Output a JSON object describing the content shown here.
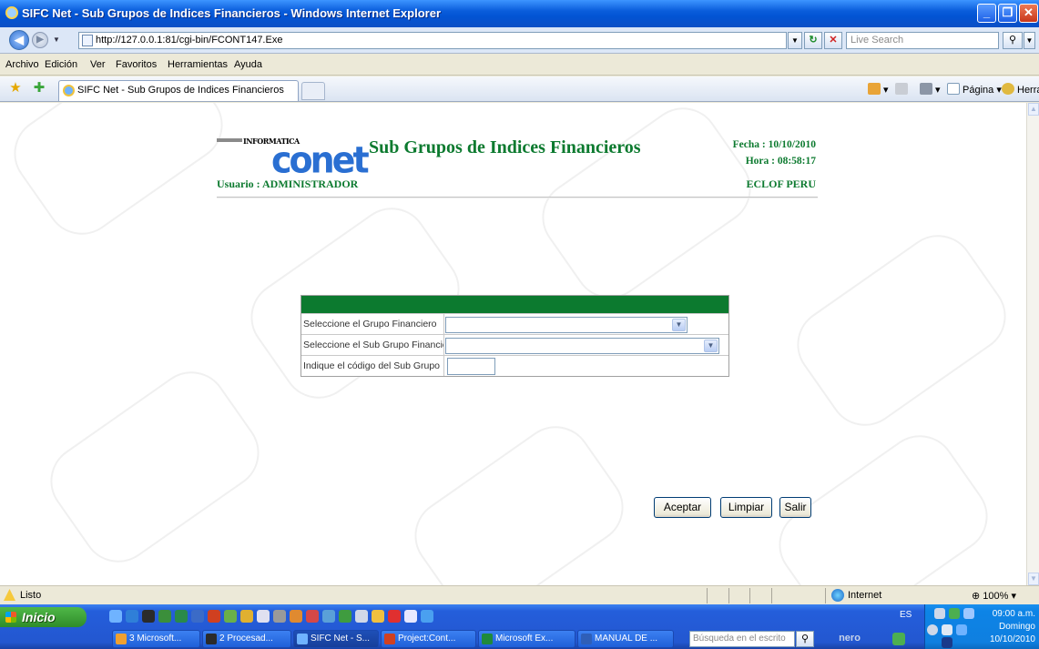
{
  "window": {
    "title": "SIFC Net - Sub Grupos de Indices Financieros - Windows Internet Explorer"
  },
  "address_bar": {
    "url": "http://127.0.0.1:81/cgi-bin/FCONT147.Exe",
    "search_placeholder": "Live Search"
  },
  "menu": [
    "Archivo",
    "Edición",
    "Ver",
    "Favoritos",
    "Herramientas",
    "Ayuda"
  ],
  "tabs": {
    "active_tab": "SIFC Net - Sub Grupos de Indices Financieros",
    "commands": {
      "page": "Página",
      "tools": "Herramientas"
    }
  },
  "page": {
    "logo_top": "INFORMATICA",
    "logo_main": "conet",
    "title": "Sub Grupos de Indices Financieros",
    "fecha": "Fecha : 10/10/2010",
    "hora": "Hora : 08:58:17",
    "usuario": "Usuario :  ADMINISTRADOR",
    "company": "ECLOF PERU"
  },
  "form": {
    "rows": [
      {
        "label": "Seleccione el Grupo Financiero",
        "value": ""
      },
      {
        "label": "Seleccione el Sub Grupo Financiero",
        "value": ""
      },
      {
        "label": "Indique el código del Sub Grupo",
        "value": ""
      }
    ],
    "buttons": {
      "accept": "Aceptar",
      "clear": "Limpiar",
      "exit": "Salir"
    }
  },
  "status_bar": {
    "status": "Listo",
    "zone": "Internet",
    "zoom": "100%"
  },
  "taskbar": {
    "start": "Inicio",
    "items": [
      {
        "label": "3 Microsoft...",
        "color": "#f0a030"
      },
      {
        "label": "2 Procesad...",
        "color": "#2b2b2b"
      },
      {
        "label": "SIFC Net - S...",
        "color": "#6fb3ff"
      },
      {
        "label": "Project:Cont...",
        "color": "#d04020"
      },
      {
        "label": "Microsoft Ex...",
        "color": "#1f8a3c"
      },
      {
        "label": "MANUAL DE ...",
        "color": "#2f5fb8"
      }
    ],
    "desktop_search": "Búsqueda en el escrito",
    "nero": "nero",
    "language": "ES",
    "time": "09:00 a.m.",
    "day": "Domingo",
    "date": "10/10/2010"
  },
  "colors": {
    "title_green": "#0c7a2f",
    "form_header": "#0c7a2f",
    "logo_blue": "#2a6fd2"
  }
}
